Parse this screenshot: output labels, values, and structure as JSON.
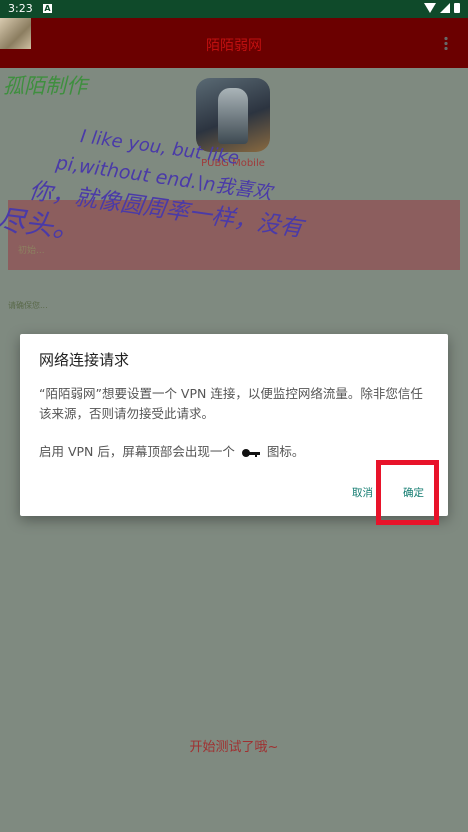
{
  "status_bar": {
    "time": "3:23",
    "notification_icon": "A"
  },
  "app_bar": {
    "title": "陌陌弱网"
  },
  "content": {
    "author_label": "孤陌制作",
    "icon_caption": "PUBG Mobile",
    "marquee_lines": [
      "I like you, but like",
      "pi,without end.\\n我喜欢",
      "你，就像圆周率一样，没有",
      "尽头。"
    ],
    "info_sub": "初始...",
    "settings_hint": "请确保您..."
  },
  "dialog": {
    "title": "网络连接请求",
    "body": "“陌陌弱网”想要设置一个 VPN 连接，以便监控网络流量。除非您信任该来源，否则请勿接受此请求。",
    "body2_before": "启用 VPN 后，屏幕顶部会出现一个",
    "body2_after": "图标。",
    "cancel_label": "取消",
    "ok_label": "确定"
  },
  "bottom_text": "开始测试了哦~",
  "colors": {
    "app_bar": "#6b0000",
    "status_bar": "#0f4a2a",
    "dialog_button": "#0f7a6e",
    "highlight": "#e8132a"
  }
}
